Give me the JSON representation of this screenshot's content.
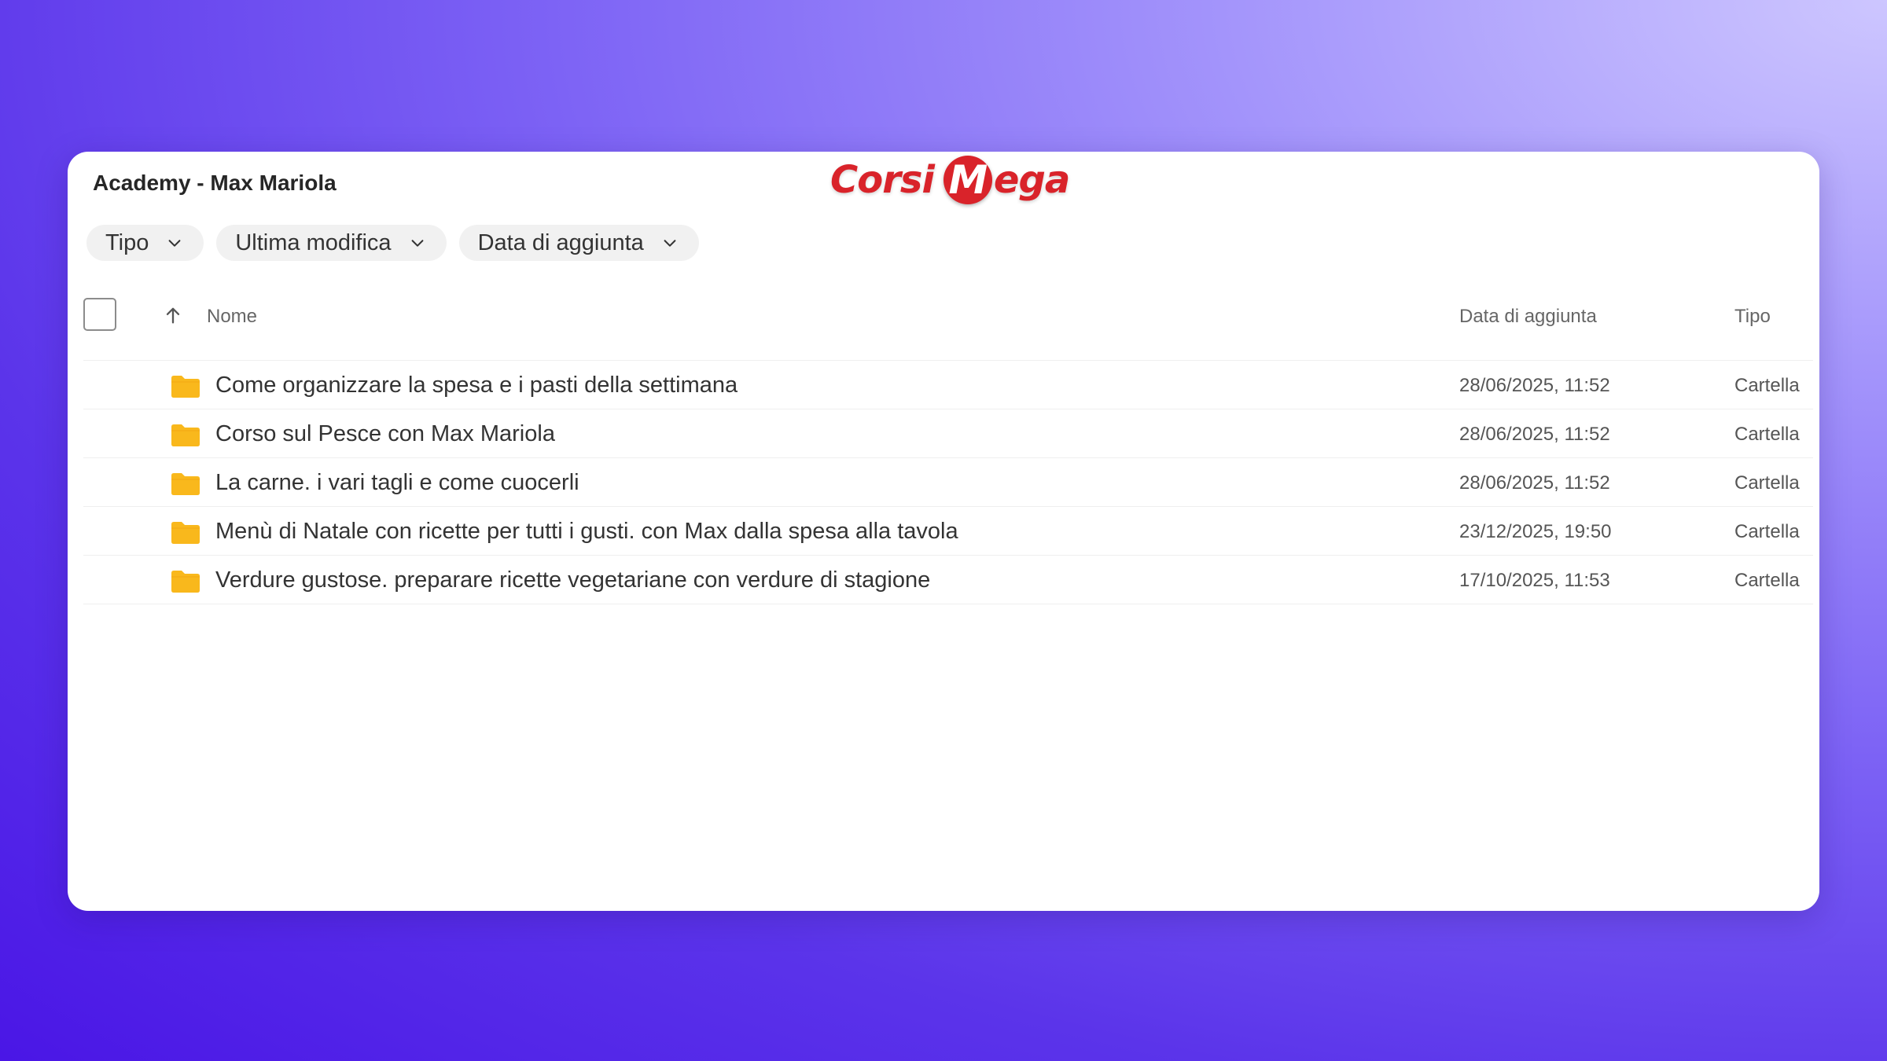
{
  "window": {
    "title": "Academy - Max Mariola"
  },
  "logo": {
    "part1": "Corsi",
    "m_letter": "M",
    "part2": "ega",
    "color": "#d9232a"
  },
  "filters": [
    {
      "label": "Tipo"
    },
    {
      "label": "Ultima modifica"
    },
    {
      "label": "Data di aggiunta"
    }
  ],
  "table": {
    "columns": {
      "name": "Nome",
      "date_added": "Data di aggiunta",
      "type": "Tipo"
    },
    "rows": [
      {
        "name": "Come organizzare la spesa e i pasti della settimana",
        "date": "28/06/2025, 11:52",
        "type": "Cartella",
        "icon": "folder-icon"
      },
      {
        "name": "Corso sul Pesce con Max Mariola",
        "date": "28/06/2025, 11:52",
        "type": "Cartella",
        "icon": "folder-icon"
      },
      {
        "name": "La carne. i vari tagli e come cuocerli",
        "date": "28/06/2025, 11:52",
        "type": "Cartella",
        "icon": "folder-icon"
      },
      {
        "name": "Menù di Natale con ricette per tutti i gusti. con Max dalla spesa alla tavola",
        "date": "23/12/2025, 19:50",
        "type": "Cartella",
        "icon": "folder-icon"
      },
      {
        "name": "Verdure gustose. preparare ricette vegetariane con verdure di stagione",
        "date": "17/10/2025, 11:53",
        "type": "Cartella",
        "icon": "folder-icon"
      }
    ]
  },
  "colors": {
    "folder": "#f9b81c",
    "background_start": "#cdc6ff",
    "background_end": "#4a16e6"
  }
}
